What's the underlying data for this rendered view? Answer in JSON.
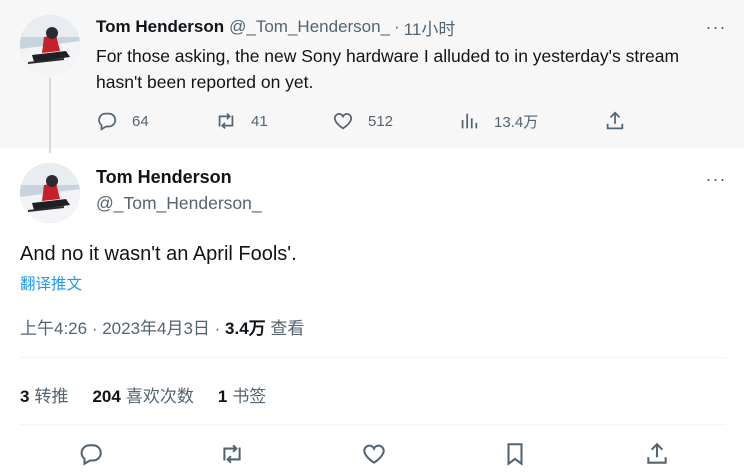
{
  "parent_tweet": {
    "display_name": "Tom Henderson",
    "handle": "@_Tom_Henderson_",
    "separator": "·",
    "time": "11小时",
    "more_icon": "···",
    "text": "For those asking, the new Sony hardware I alluded to in yesterday's stream hasn't been reported on yet.",
    "actions": {
      "replies": "64",
      "retweets": "41",
      "likes": "512",
      "views": "13.4万"
    }
  },
  "main_tweet": {
    "display_name": "Tom Henderson",
    "handle": "@_Tom_Henderson_",
    "more_icon": "···",
    "text": "And no it wasn't an April Fools'.",
    "translate_link": "翻译推文",
    "meta": {
      "time": "上午4:26",
      "sep1": " · ",
      "date": "2023年4月3日",
      "sep2": " · ",
      "views_count": "3.4万",
      "views_label": " 查看"
    },
    "stats": {
      "retweets_count": "3",
      "retweets_label": "转推",
      "likes_count": "204",
      "likes_label": "喜欢次数",
      "bookmarks_count": "1",
      "bookmarks_label": "书签"
    }
  },
  "icons": [
    "reply-icon",
    "retweet-icon",
    "like-icon",
    "views-icon",
    "share-icon",
    "bookmark-icon",
    "more-icon"
  ],
  "colors": {
    "parent_background": "#f7f7f7",
    "text_primary": "#0f1419",
    "text_secondary": "#536471",
    "link": "#1d9bf0",
    "divider": "#eff3f4"
  }
}
